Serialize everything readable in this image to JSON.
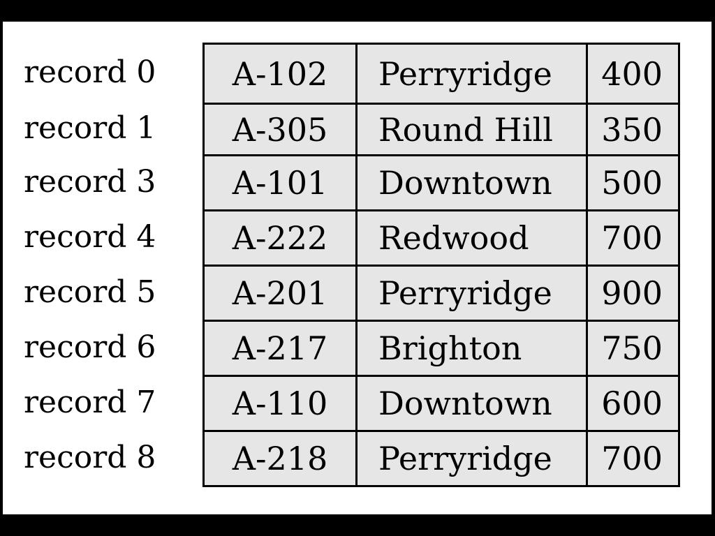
{
  "records": [
    {
      "label": "record 0",
      "account": "A-102",
      "branch": "Perryridge",
      "balance": "400"
    },
    {
      "label": "record 1",
      "account": "A-305",
      "branch": "Round Hill",
      "balance": "350"
    },
    {
      "label": "record 3",
      "account": "A-101",
      "branch": "Downtown",
      "balance": "500"
    },
    {
      "label": "record 4",
      "account": "A-222",
      "branch": "Redwood",
      "balance": "700"
    },
    {
      "label": "record 5",
      "account": "A-201",
      "branch": "Perryridge",
      "balance": "900"
    },
    {
      "label": "record 6",
      "account": "A-217",
      "branch": "Brighton",
      "balance": "750"
    },
    {
      "label": "record 7",
      "account": "A-110",
      "branch": "Downtown",
      "balance": "600"
    },
    {
      "label": "record 8",
      "account": "A-218",
      "branch": "Perryridge",
      "balance": "700"
    }
  ]
}
